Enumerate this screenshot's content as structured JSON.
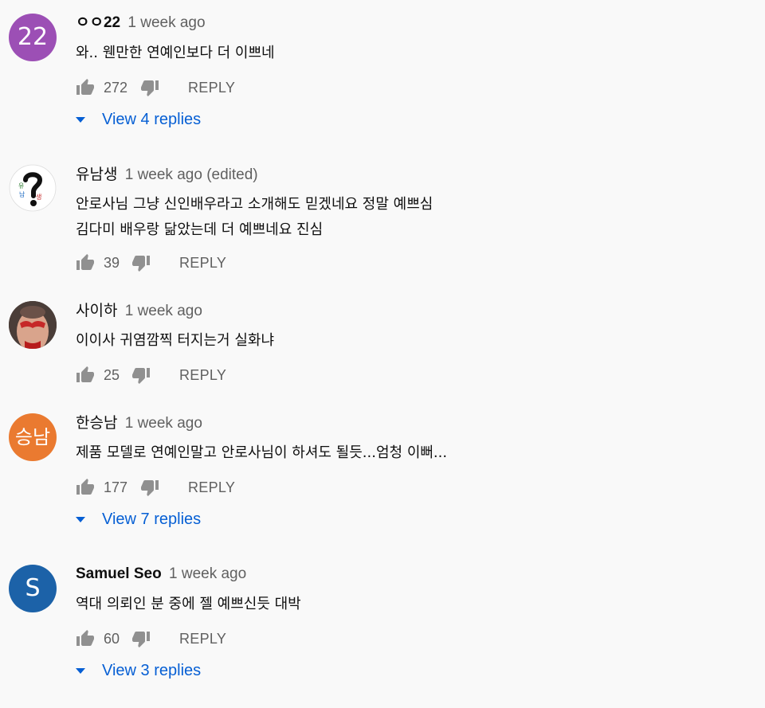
{
  "comments": [
    {
      "author": "ㅇㅇ22",
      "time": "1 week ago",
      "text": [
        "와.. 웬만한 연예인보다 더 이쁘네"
      ],
      "likes": "272",
      "reply_label": "REPLY",
      "view_replies": "View 4 replies",
      "avatar": {
        "type": "initials",
        "text": "22",
        "color": "#9c4fb5"
      }
    },
    {
      "author": "유남생",
      "time": "1 week ago (edited)",
      "text": [
        "안로사님 그냥 신인배우라고 소개해도 믿겠네요 정말 예쁘심",
        "김다미 배우랑 닮았는데 더 예쁘네요 진심"
      ],
      "likes": "39",
      "reply_label": "REPLY",
      "avatar": {
        "type": "image",
        "icon": "question-mark-logo"
      }
    },
    {
      "author": "사이하",
      "time": "1 week ago",
      "text": [
        "이이사 귀염깜찍 터지는거 실화냐"
      ],
      "likes": "25",
      "reply_label": "REPLY",
      "avatar": {
        "type": "image",
        "icon": "photo"
      }
    },
    {
      "author": "한승남",
      "time": "1 week ago",
      "text": [
        "제품 모델로 연예인말고 안로사님이 하셔도 될듯...엄청 이뻐..."
      ],
      "likes": "177",
      "reply_label": "REPLY",
      "view_replies": "View 7 replies",
      "avatar": {
        "type": "initials",
        "text": "승남",
        "color": "#ea7a30"
      }
    },
    {
      "author": "Samuel Seo",
      "time": "1 week ago",
      "text": [
        "역대 의뢰인 분 중에 젤 예쁘신듯 대박"
      ],
      "likes": "60",
      "reply_label": "REPLY",
      "view_replies": "View 3 replies",
      "avatar": {
        "type": "initials",
        "text": "S",
        "color": "#1c62a8"
      }
    }
  ],
  "colors": {
    "background": "#f9f9f9",
    "link": "#065fd4",
    "secondary_text": "#606060",
    "icon": "#909090"
  }
}
